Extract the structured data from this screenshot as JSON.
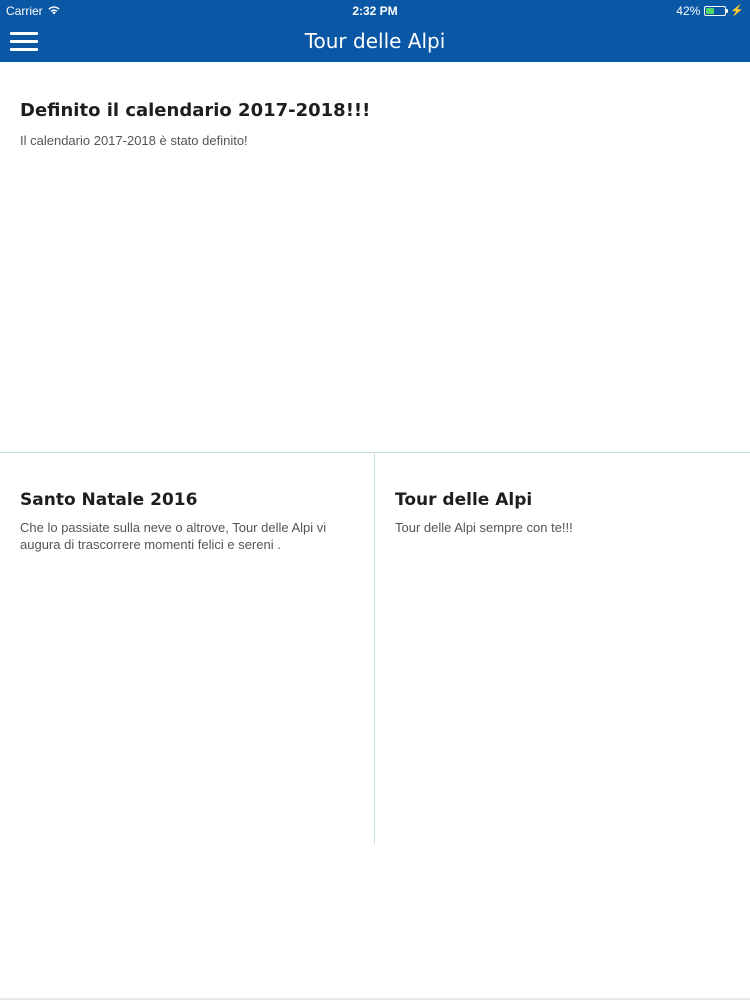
{
  "status_bar": {
    "carrier": "Carrier",
    "time": "2:32 PM",
    "battery_percent": "42%",
    "battery_level": 0.42,
    "icons": [
      "wifi-icon",
      "battery-icon",
      "charging-bolt-icon"
    ]
  },
  "header": {
    "title": "Tour delle Alpi",
    "menu_icon": "hamburger-menu-icon",
    "background_color": "#0a57a6"
  },
  "news": [
    {
      "title": "Definito il calendario 2017-2018!!!",
      "body": "Il calendario 2017-2018 è stato definito!"
    },
    {
      "title": "Santo Natale 2016",
      "body": "Che lo passiate sulla neve o altrove, Tour delle Alpi vi augura di trascorrere momenti felici e sereni ."
    },
    {
      "title": "Tour delle Alpi",
      "body": "Tour delle Alpi sempre con te!!!"
    }
  ]
}
